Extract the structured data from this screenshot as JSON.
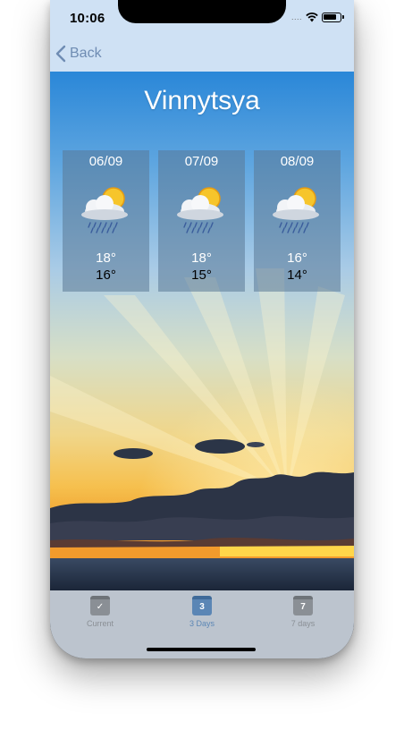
{
  "status_bar": {
    "time": "10:06",
    "signal": "....",
    "wifi_icon": "wifi-icon",
    "battery_icon": "battery-icon"
  },
  "nav": {
    "back_label": "Back",
    "back_icon": "chevron-left-icon"
  },
  "city": "Vinnytsya",
  "forecast": [
    {
      "date": "06/09",
      "max": "18°",
      "min": "16°",
      "icon": "partly-sunny-rain-icon"
    },
    {
      "date": "07/09",
      "max": "18°",
      "min": "15°",
      "icon": "partly-sunny-rain-icon"
    },
    {
      "date": "08/09",
      "max": "16°",
      "min": "14°",
      "icon": "partly-sunny-rain-icon"
    }
  ],
  "tabs": [
    {
      "label": "Current",
      "glyph": "✓",
      "icon": "calendar-check-icon",
      "selected": false
    },
    {
      "label": "3 Days",
      "glyph": "3",
      "icon": "calendar-3-icon",
      "selected": true
    },
    {
      "label": "7 days",
      "glyph": "7",
      "icon": "calendar-7-icon",
      "selected": false
    }
  ],
  "colors": {
    "nav_background": "#cfe1f4",
    "accent": "#6f8cb3",
    "tab_selected": "#5b86b5",
    "tab_unselected": "#8a8f95",
    "tabbar_background": "#bcc4ce"
  }
}
